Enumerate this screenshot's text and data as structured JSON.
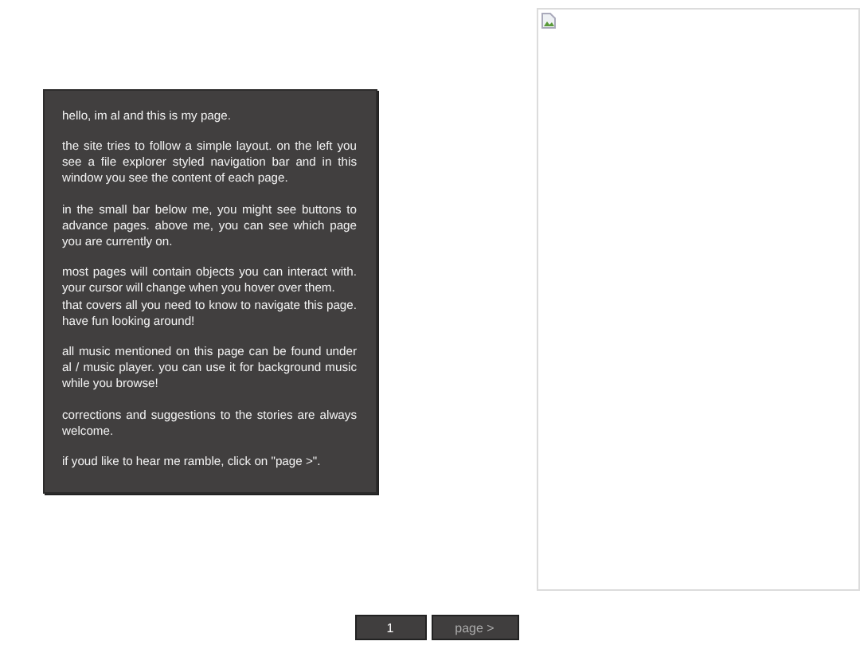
{
  "content": {
    "paragraphs": [
      "hello, im al and this is my page.",
      "the site tries to follow a simple layout. on the left you see a file explorer styled navigation bar and in this window you see the content of each page.",
      "in the small bar below me, you might see buttons to advance pages. above me, you can see which page you are currently on.",
      "most pages will contain objects you can interact with. your cursor will change when you hover over them.\nthat covers all you need to know to navigate this page. have fun looking around!",
      "all music mentioned on this page can be found under al / music player. you can use it for background music while you browse!",
      "corrections and suggestions to the stories are always welcome.",
      "if youd like to hear me ramble, click on \"page >\"."
    ]
  },
  "pager": {
    "current": "1",
    "next": "page >"
  }
}
